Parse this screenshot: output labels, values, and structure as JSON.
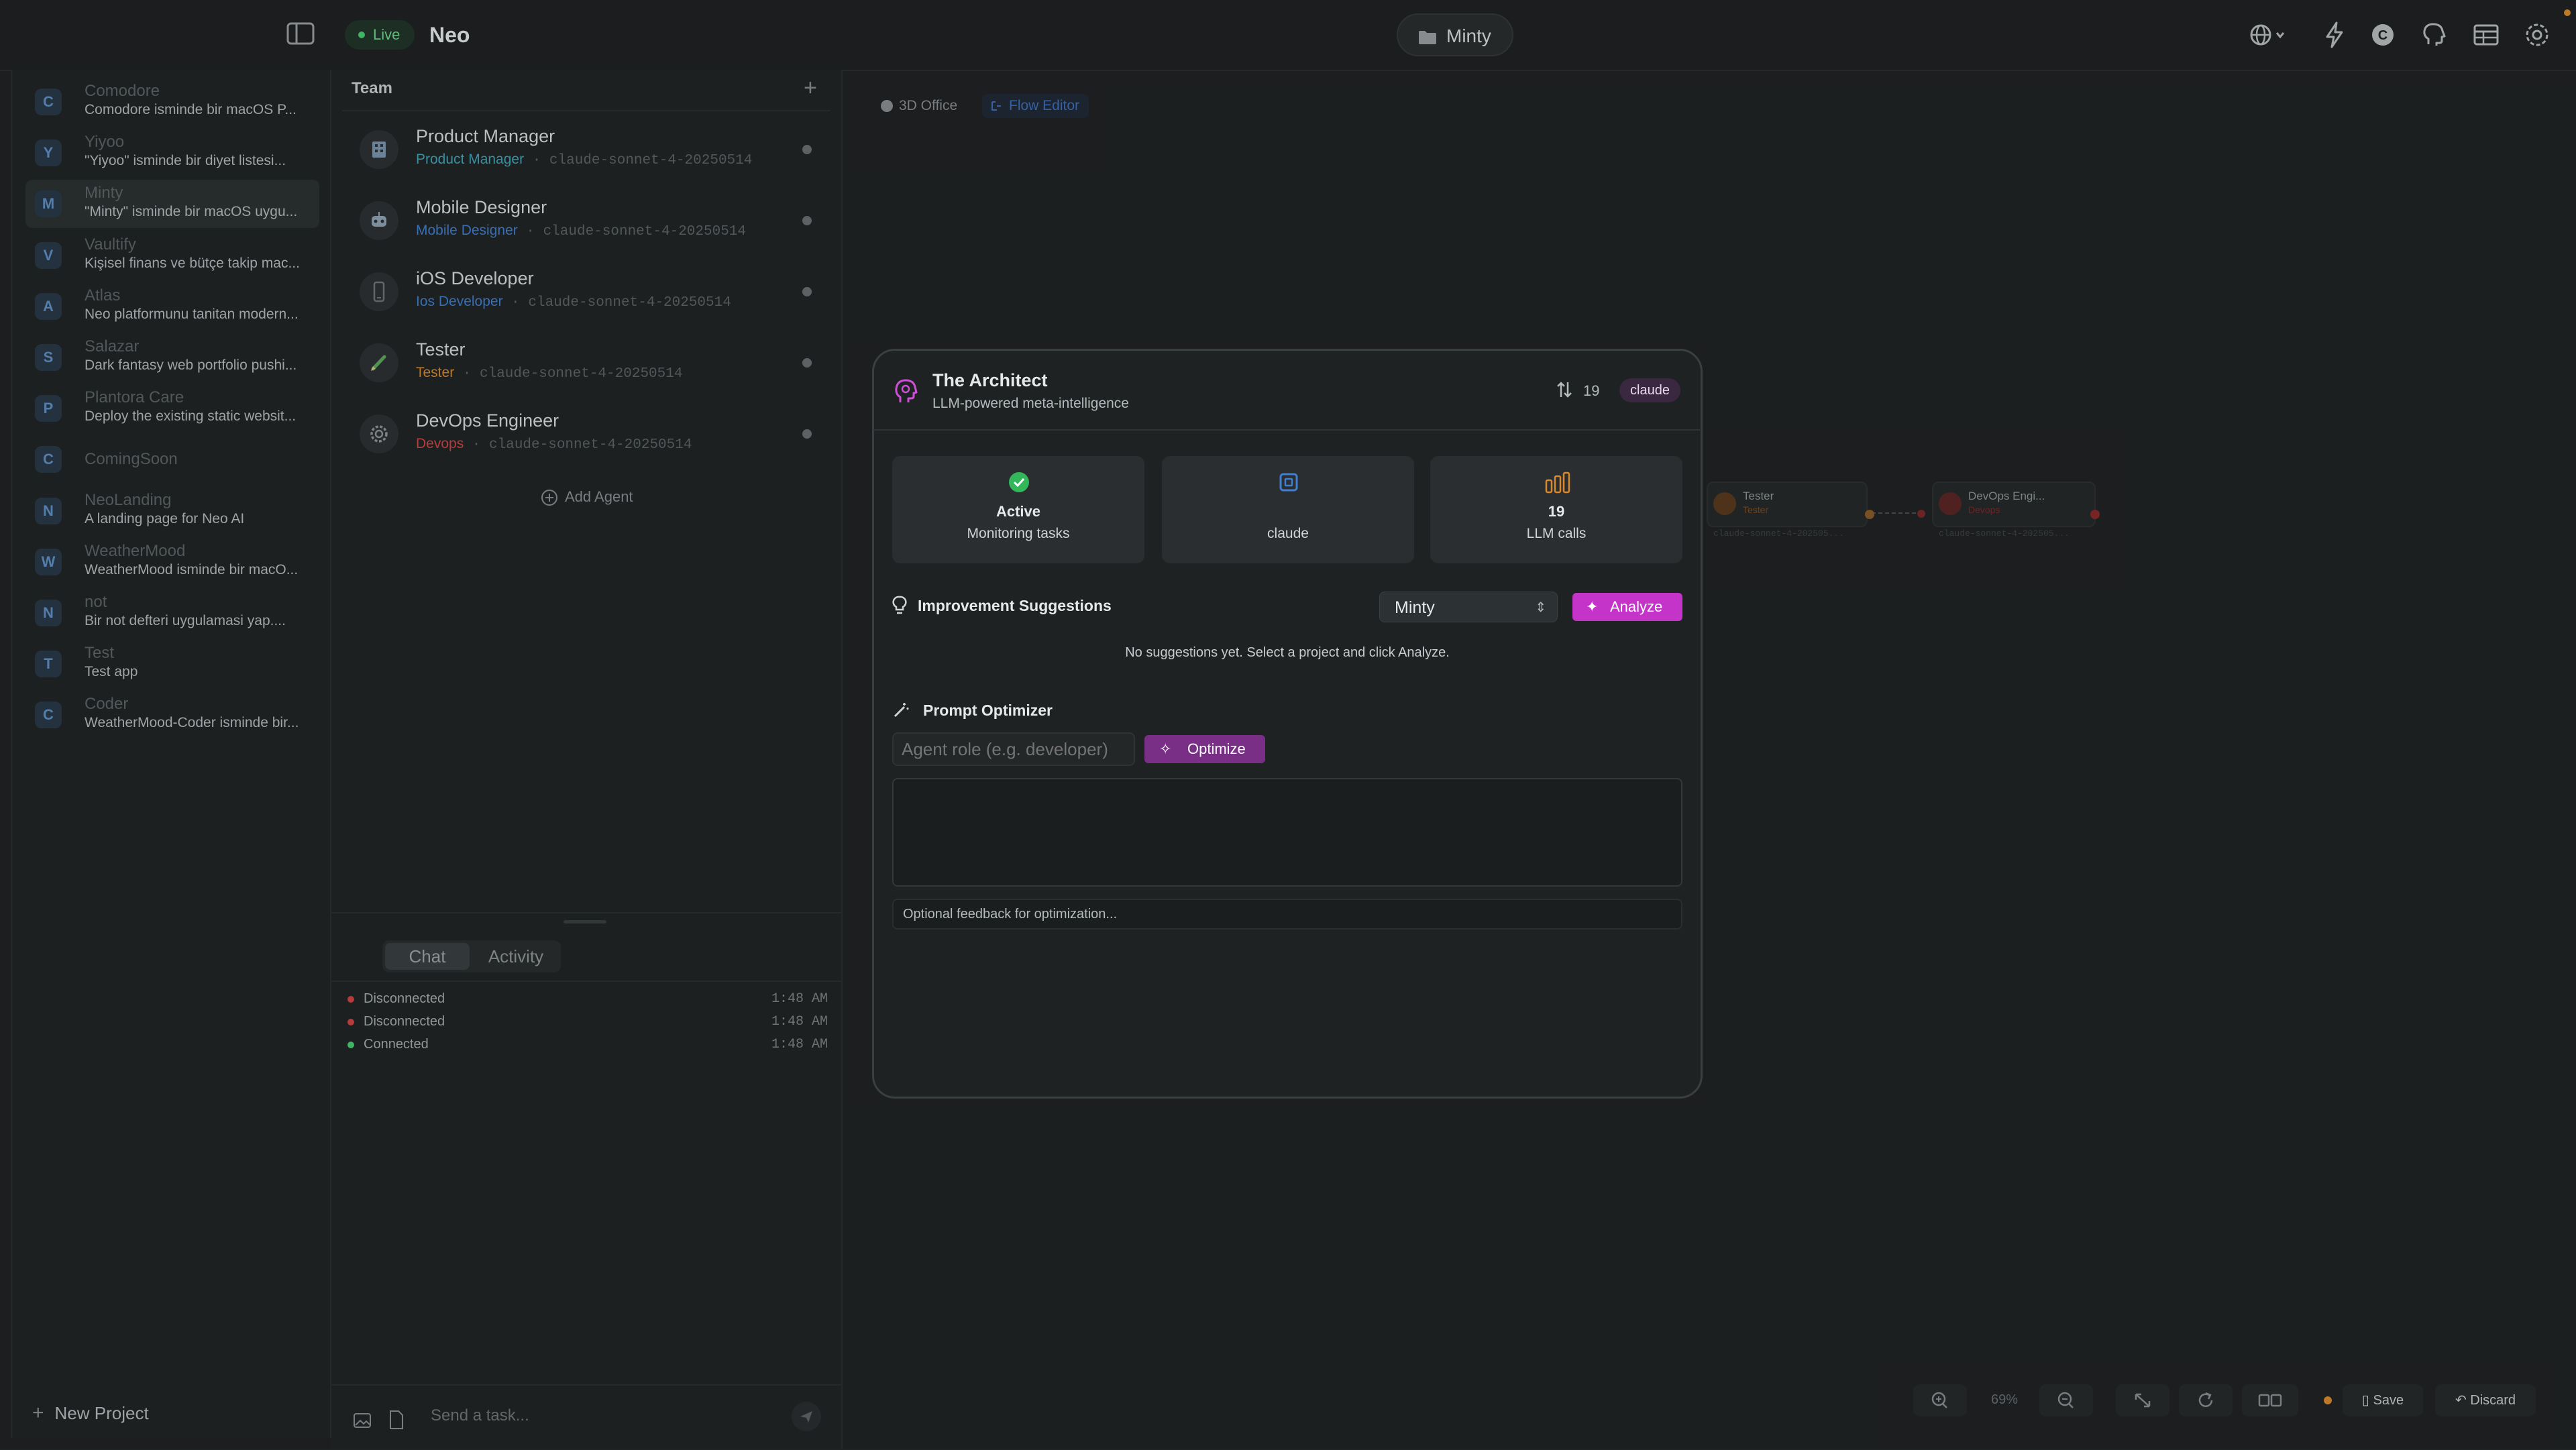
{
  "header": {
    "live_label": "Live",
    "app_title": "Neo",
    "project_name": "Minty",
    "icons": [
      "sidebar-toggle-icon",
      "globe-icon",
      "bolt-icon",
      "claude-icon",
      "brain-icon",
      "table-icon",
      "gear-icon"
    ]
  },
  "sidebar": {
    "projects": [
      {
        "initial": "C",
        "name": "Comodore",
        "desc": "Comodore isminde bir macOS P..."
      },
      {
        "initial": "Y",
        "name": "Yiyoo",
        "desc": "\"Yiyoo\" isminde bir diyet listesi..."
      },
      {
        "initial": "M",
        "name": "Minty",
        "desc": "\"Minty\" isminde bir macOS uygu..."
      },
      {
        "initial": "V",
        "name": "Vaultify",
        "desc": "Kişisel finans ve bütçe takip mac..."
      },
      {
        "initial": "A",
        "name": "Atlas",
        "desc": "Neo platformunu tanitan modern..."
      },
      {
        "initial": "S",
        "name": "Salazar",
        "desc": "Dark fantasy web portfolio pushi..."
      },
      {
        "initial": "P",
        "name": "Plantora Care",
        "desc": "Deploy the existing static websit..."
      },
      {
        "initial": "C",
        "name": "ComingSoon",
        "desc": ""
      },
      {
        "initial": "N",
        "name": "NeoLanding",
        "desc": "A landing page for Neo AI"
      },
      {
        "initial": "W",
        "name": "WeatherMood",
        "desc": "WeatherMood isminde bir macO..."
      },
      {
        "initial": "N",
        "name": "not",
        "desc": "Bir not defteri uygulamasi yap...."
      },
      {
        "initial": "T",
        "name": "Test",
        "desc": "Test app"
      },
      {
        "initial": "C",
        "name": "Coder",
        "desc": "WeatherMood-Coder isminde bir..."
      }
    ],
    "selected_index": 2,
    "new_project_label": "New Project"
  },
  "team": {
    "header": "Team",
    "agents": [
      {
        "name": "Product Manager",
        "role": "Product Manager",
        "role_color": "#3fa6b8",
        "model": "claude-sonnet-4-20250514",
        "icon": "building-icon"
      },
      {
        "name": "Mobile Designer",
        "role": "Mobile Designer",
        "role_color": "#3e7fd0",
        "model": "claude-sonnet-4-20250514",
        "icon": "robot-icon"
      },
      {
        "name": "iOS Developer",
        "role": "Ios Developer",
        "role_color": "#3e7fd0",
        "model": "claude-sonnet-4-20250514",
        "icon": "phone-icon"
      },
      {
        "name": "Tester",
        "role": "Tester",
        "role_color": "#d8892e",
        "model": "claude-sonnet-4-20250514",
        "icon": "pencil-icon"
      },
      {
        "name": "DevOps Engineer",
        "role": "Devops",
        "role_color": "#d04545",
        "model": "claude-sonnet-4-20250514",
        "icon": "gear-icon"
      }
    ],
    "add_agent_label": "Add Agent"
  },
  "chat": {
    "tabs": [
      "Chat",
      "Activity"
    ],
    "active_tab": "Activity",
    "log": [
      {
        "status": "Disconnected",
        "time": "1:48 AM",
        "color": "#d04545"
      },
      {
        "status": "Disconnected",
        "time": "1:48 AM",
        "color": "#d04545"
      },
      {
        "status": "Connected",
        "time": "1:48 AM",
        "color": "#4ccb72"
      }
    ],
    "input_placeholder": "Send a task..."
  },
  "canvas": {
    "tabs": [
      "3D Office",
      "Flow Editor"
    ],
    "active_tab": "Flow Editor",
    "nodes": [
      {
        "name": "Tester",
        "role": "Tester",
        "model": "claude-sonnet-4-202505...",
        "color": "#d8892e"
      },
      {
        "name": "DevOps Engi...",
        "role": "Devops",
        "model": "claude-sonnet-4-202505...",
        "color": "#d04545"
      }
    ],
    "zoom_label": "69%",
    "save_label": "Save",
    "discard_label": "Discard"
  },
  "architect": {
    "title": "The Architect",
    "subtitle": "LLM-powered meta-intelligence",
    "call_count": "19",
    "model_badge": "claude",
    "stats": [
      {
        "value": "Active",
        "label": "Monitoring tasks",
        "icon": "check-circle-icon"
      },
      {
        "value": "",
        "label": "claude",
        "icon": "cpu-icon"
      },
      {
        "value": "19",
        "label": "LLM calls",
        "icon": "bar-chart-icon"
      }
    ],
    "suggestions_title": "Improvement Suggestions",
    "selected_project": "Minty",
    "analyze_label": "Analyze",
    "empty_message": "No suggestions yet. Select a project and click Analyze.",
    "optimizer_title": "Prompt Optimizer",
    "role_placeholder": "Agent role (e.g. developer)",
    "optimize_label": "Optimize",
    "feedback_placeholder": "Optional feedback for optimization...",
    "colors": {
      "accent": "#c434c9",
      "optimize": "#7a2f86",
      "success": "#4ccb72",
      "info": "#3e7fd0",
      "warning": "#d8892e"
    }
  }
}
